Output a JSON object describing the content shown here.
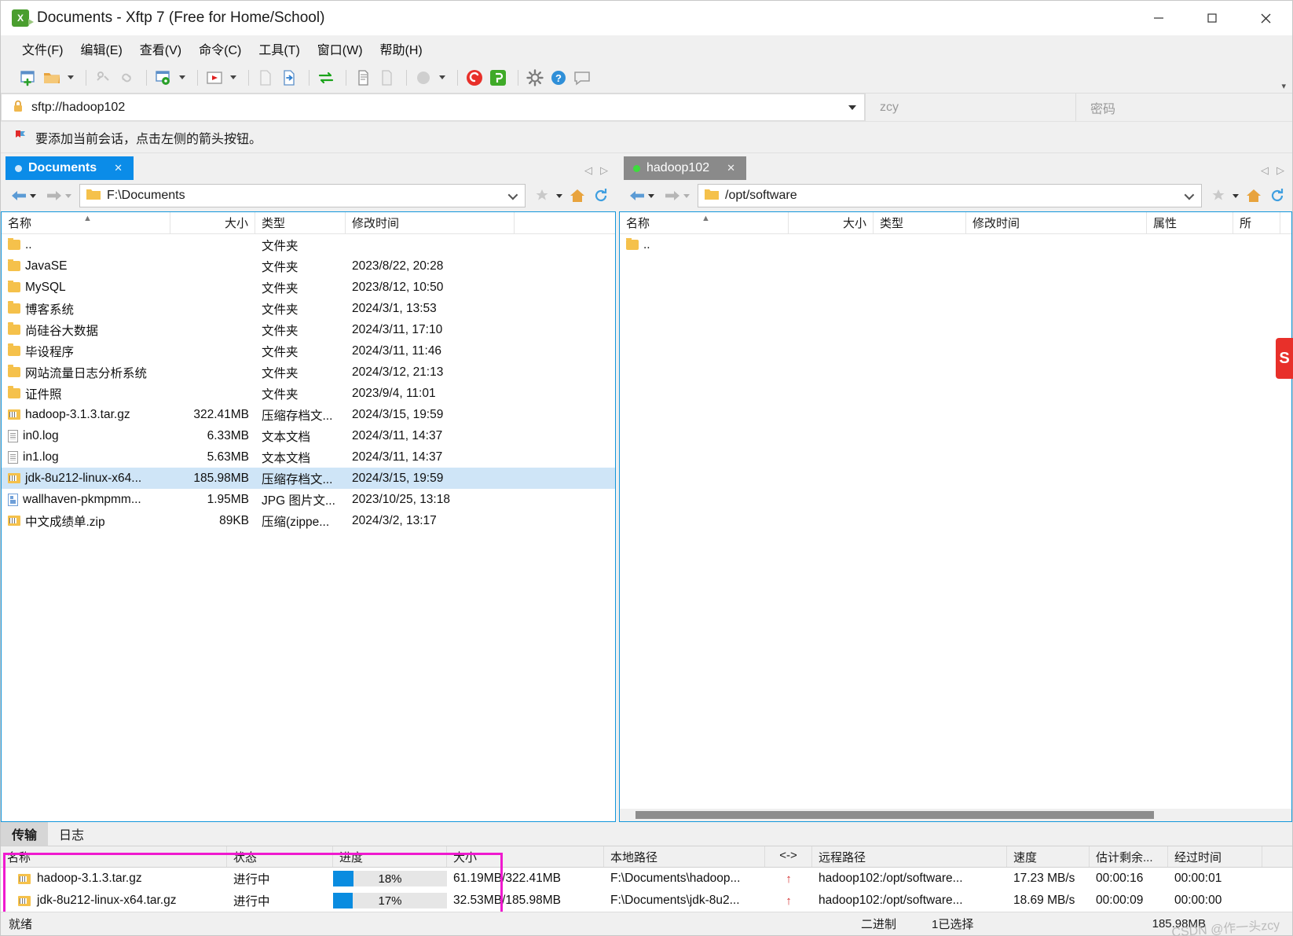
{
  "window": {
    "title": "Documents - Xftp 7 (Free for Home/School)",
    "minimize": "─",
    "maximize": "☐",
    "close": "✕"
  },
  "menubar": [
    {
      "label": "文件(F)"
    },
    {
      "label": "编辑(E)"
    },
    {
      "label": "查看(V)"
    },
    {
      "label": "命令(C)"
    },
    {
      "label": "工具(T)"
    },
    {
      "label": "窗口(W)"
    },
    {
      "label": "帮助(H)"
    }
  ],
  "toolbar": {
    "overflow": "▾",
    "buttons": [
      "new-session-icon",
      "open-folder-icon",
      "dropdown-1",
      "disconnect-icon",
      "link-icon",
      "session-settings-icon",
      "dropdown-2",
      "run-icon",
      "dropdown-3",
      "new-file-icon",
      "transfer-file-icon",
      "sync-transfer-icon",
      "copy-icon",
      "paste-icon",
      "status-circle-icon",
      "dropdown-4",
      "xshell-icon",
      "xftp-icon",
      "options-icon",
      "help-icon",
      "feedback-icon"
    ]
  },
  "address": {
    "url": "sftp://hadoop102",
    "user_value": "zcy",
    "password_placeholder": "密码",
    "lock_icon": "lock-icon",
    "dropdown_icon": "chevron-down-icon"
  },
  "hint": {
    "icon": "bookmark-flag-icon",
    "text": "要添加当前会话，点击左侧的箭头按钮。"
  },
  "left_panel": {
    "tab": {
      "label": "Documents",
      "close": "✕",
      "status_dot": "session-dot"
    },
    "path": "F:\\Documents",
    "nav": {
      "back": "back-arrow-icon",
      "forward": "forward-arrow-icon",
      "favorite": "star-icon",
      "home": "home-icon",
      "refresh": "refresh-icon"
    },
    "columns": [
      "名称",
      "大小",
      "类型",
      "修改时间"
    ],
    "rows": [
      {
        "name": "..",
        "size": "",
        "type": "文件夹",
        "time": "",
        "icon": "folder",
        "selected": false
      },
      {
        "name": "JavaSE",
        "size": "",
        "type": "文件夹",
        "time": "2023/8/22, 20:28",
        "icon": "folder",
        "selected": false
      },
      {
        "name": "MySQL",
        "size": "",
        "type": "文件夹",
        "time": "2023/8/12, 10:50",
        "icon": "folder",
        "selected": false
      },
      {
        "name": "博客系统",
        "size": "",
        "type": "文件夹",
        "time": "2024/3/1, 13:53",
        "icon": "folder",
        "selected": false
      },
      {
        "name": "尚硅谷大数据",
        "size": "",
        "type": "文件夹",
        "time": "2024/3/11, 17:10",
        "icon": "folder",
        "selected": false
      },
      {
        "name": "毕设程序",
        "size": "",
        "type": "文件夹",
        "time": "2024/3/11, 11:46",
        "icon": "folder",
        "selected": false
      },
      {
        "name": "网站流量日志分析系统",
        "size": "",
        "type": "文件夹",
        "time": "2024/3/12, 21:13",
        "icon": "folder",
        "selected": false
      },
      {
        "name": "证件照",
        "size": "",
        "type": "文件夹",
        "time": "2023/9/4, 11:01",
        "icon": "folder",
        "selected": false
      },
      {
        "name": "hadoop-3.1.3.tar.gz",
        "size": "322.41MB",
        "type": "压缩存档文...",
        "time": "2024/3/15, 19:59",
        "icon": "zip",
        "selected": false
      },
      {
        "name": "in0.log",
        "size": "6.33MB",
        "type": "文本文档",
        "time": "2024/3/11, 14:37",
        "icon": "txt",
        "selected": false
      },
      {
        "name": "in1.log",
        "size": "5.63MB",
        "type": "文本文档",
        "time": "2024/3/11, 14:37",
        "icon": "txt",
        "selected": false
      },
      {
        "name": "jdk-8u212-linux-x64...",
        "size": "185.98MB",
        "type": "压缩存档文...",
        "time": "2024/3/15, 19:59",
        "icon": "zip",
        "selected": true
      },
      {
        "name": "wallhaven-pkmpmm...",
        "size": "1.95MB",
        "type": "JPG 图片文...",
        "time": "2023/10/25, 13:18",
        "icon": "img",
        "selected": false
      },
      {
        "name": "中文成绩单.zip",
        "size": "89KB",
        "type": "压缩(zippe...",
        "time": "2024/3/2, 13:17",
        "icon": "zip",
        "selected": false
      }
    ]
  },
  "right_panel": {
    "tab": {
      "label": "hadoop102",
      "close": "✕",
      "status_dot": "connected-dot"
    },
    "path": "/opt/software",
    "nav": {
      "back": "back-arrow-icon",
      "forward": "forward-arrow-icon",
      "favorite": "star-icon",
      "home": "home-icon",
      "refresh": "refresh-icon"
    },
    "columns": [
      "名称",
      "大小",
      "类型",
      "修改时间",
      "属性",
      "所"
    ],
    "rows": [
      {
        "name": "..",
        "size": "",
        "type": "",
        "time": "",
        "attr": "",
        "owner": "",
        "icon": "folder",
        "selected": false
      }
    ]
  },
  "transfer": {
    "tabs": [
      {
        "label": "传输",
        "active": true
      },
      {
        "label": "日志",
        "active": false
      }
    ],
    "columns": [
      "名称",
      "状态",
      "进度",
      "大小",
      "本地路径",
      "<->",
      "远程路径",
      "速度",
      "估计剩余...",
      "经过时间"
    ],
    "rows": [
      {
        "name": "hadoop-3.1.3.tar.gz",
        "state": "进行中",
        "progress": 18,
        "progress_label": "18%",
        "size": "61.19MB/322.41MB",
        "local_path": "F:\\Documents\\hadoop...",
        "direction": "↑",
        "remote_path": "hadoop102:/opt/software...",
        "speed": "17.23 MB/s",
        "eta": "00:00:16",
        "elapsed": "00:00:01",
        "icon": "zip"
      },
      {
        "name": "jdk-8u212-linux-x64.tar.gz",
        "state": "进行中",
        "progress": 17,
        "progress_label": "17%",
        "size": "32.53MB/185.98MB",
        "local_path": "F:\\Documents\\jdk-8u2...",
        "direction": "↑",
        "remote_path": "hadoop102:/opt/software...",
        "speed": "18.69 MB/s",
        "eta": "00:00:09",
        "elapsed": "00:00:00",
        "icon": "zip"
      }
    ]
  },
  "statusbar": {
    "ready": "就绪",
    "mode": "二进制",
    "selection": "1已选择",
    "selected_size": "185.98MB",
    "watermark": "CSDN @作一头zcy"
  },
  "colors": {
    "accent_blue": "#0b8ce8",
    "tab_inactive": "#8a8a8a",
    "selection_blue": "#cfe5f7",
    "progress_blue": "#0a8ce0",
    "highlight_magenta": "#ef1acf",
    "folder_yellow": "#f5c14b",
    "arrow_red": "#d32f2f"
  }
}
